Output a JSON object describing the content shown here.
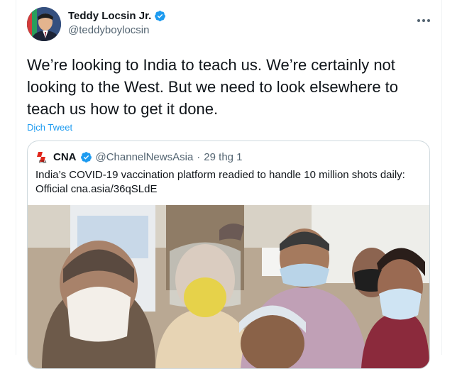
{
  "tweet": {
    "display_name": "Teddy Locsin Jr.",
    "handle": "@teddyboylocsin",
    "text": "We’re looking to India to teach us. We’re certainly not looking to the West. But we need to look elsewhere to teach us how to get it done.",
    "translate_label": "Dịch Tweet"
  },
  "quoted": {
    "name": "CNA",
    "handle": "@ChannelNewsAsia",
    "separator": "·",
    "date": "29 thg 1",
    "text": "India’s COVID-19 vaccination platform readied to handle 10 million shots daily: Official cna.asia/36qSLdE"
  },
  "colors": {
    "accent": "#1d9bf0",
    "text_secondary": "#536471",
    "border": "#cfd9de"
  },
  "icons": {
    "verified": "verified-badge-icon",
    "more": "more-options-icon"
  }
}
